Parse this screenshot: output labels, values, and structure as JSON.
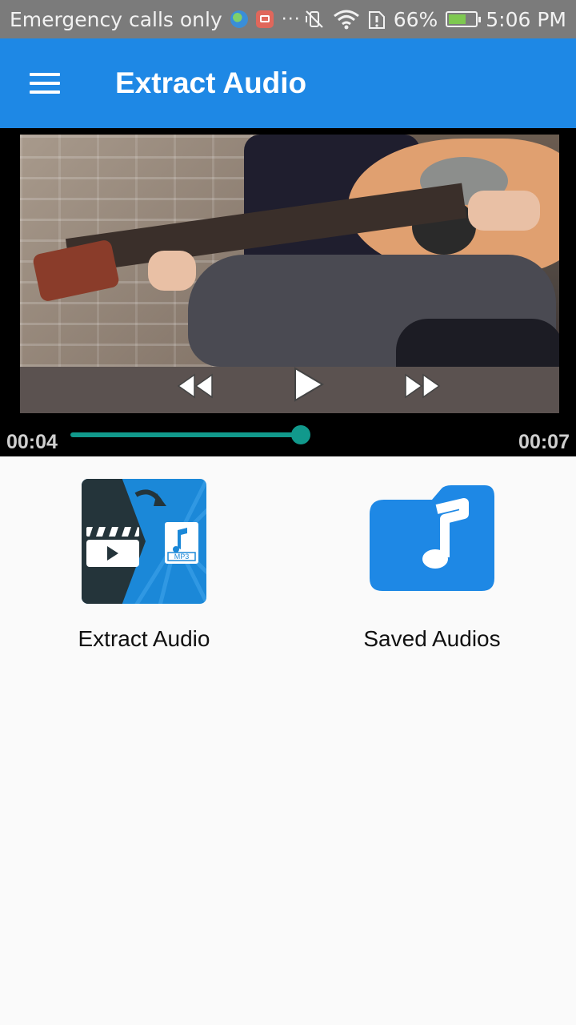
{
  "status_bar": {
    "carrier_text": "Emergency calls only",
    "more_dots": "···",
    "battery_percent": "66%",
    "time": "5:06 PM",
    "battery_level": 0.66
  },
  "app_bar": {
    "title": "Extract Audio"
  },
  "player": {
    "current_time": "00:04",
    "total_time": "00:07",
    "progress": 0.57
  },
  "tiles": [
    {
      "label": "Extract Audio",
      "icon": "extract-audio-icon",
      "badge_text": "MP3"
    },
    {
      "label": "Saved Audios",
      "icon": "music-folder-icon"
    }
  ],
  "colors": {
    "app_bar": "#1e88e5",
    "seek": "#11998c",
    "folder": "#1e88e5"
  }
}
